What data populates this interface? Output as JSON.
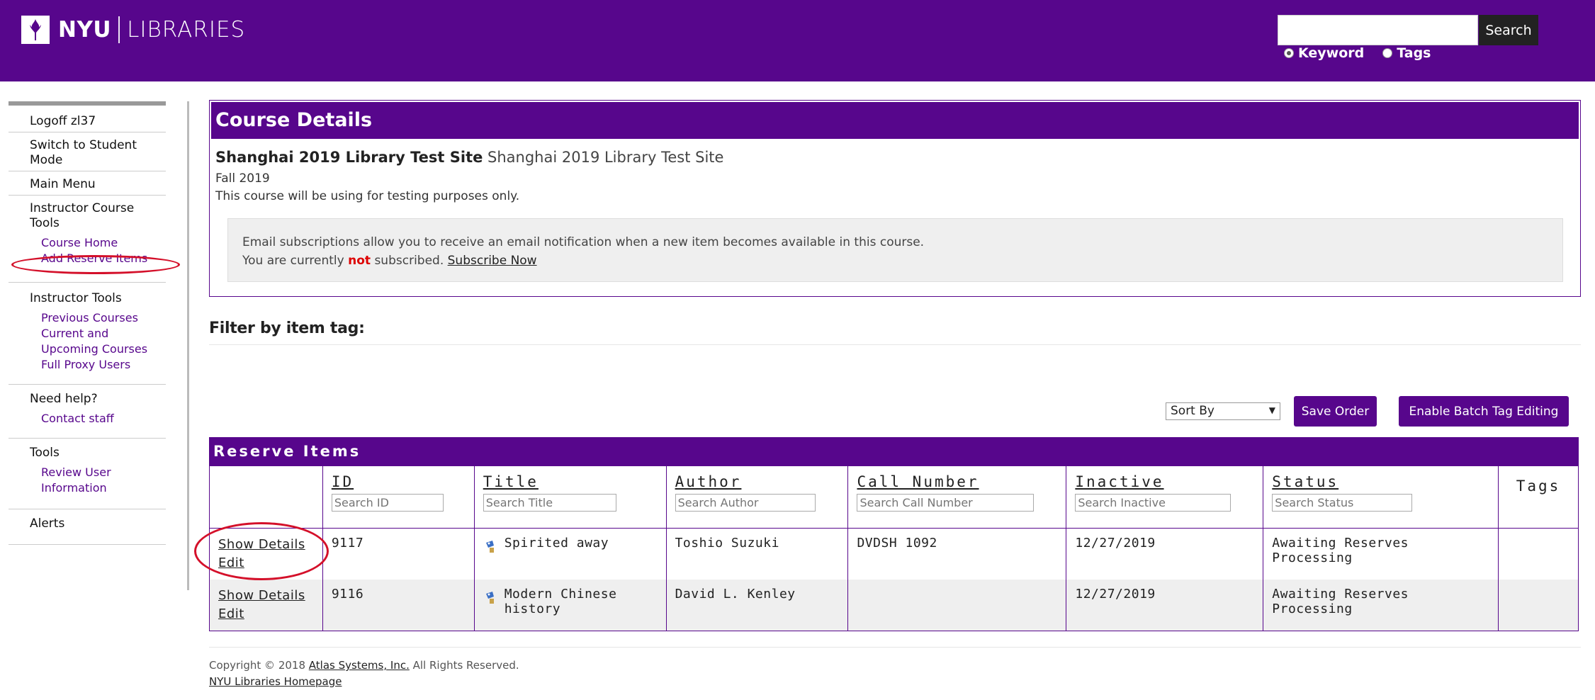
{
  "header": {
    "logo_nyu": "NYU",
    "logo_libraries": "LIBRARIES",
    "search": {
      "value": "",
      "placeholder": "",
      "button_label": "Search"
    },
    "search_type": [
      {
        "label": "Keyword",
        "selected": true
      },
      {
        "label": "Tags",
        "selected": false
      }
    ]
  },
  "sidebar": {
    "sections": [
      {
        "head": "Logoff zl37",
        "links": []
      },
      {
        "head": "Switch to Student Mode",
        "links": []
      },
      {
        "head": "Main Menu",
        "links": []
      },
      {
        "head": "Instructor Course Tools",
        "links": [
          "Course Home",
          "Add Reserve Items"
        ]
      },
      {
        "head": "Instructor Tools",
        "links": [
          "Previous Courses",
          "Current and Upcoming Courses",
          "Full Proxy Users"
        ]
      },
      {
        "head": "Need help?",
        "links": [
          "Contact staff"
        ]
      },
      {
        "head": "Tools",
        "links": [
          "Review User Information"
        ]
      },
      {
        "head": "Alerts",
        "links": []
      }
    ]
  },
  "course": {
    "heading": "Course Details",
    "name_bold": "Shanghai 2019 Library Test Site",
    "name_plain": "Shanghai 2019 Library Test Site",
    "term": "Fall 2019",
    "description": "This course will be using for testing purposes only.",
    "email_line1": "Email subscriptions allow you to receive an email notification when a new item becomes available in this course.",
    "email_line2_pre": "You are currently ",
    "email_line2_not": "not",
    "email_line2_post": " subscribed. ",
    "subscribe_label": "Subscribe Now"
  },
  "filter": {
    "title": "Filter by item tag:"
  },
  "controls": {
    "sort_label": "Sort By",
    "save_order": "Save Order",
    "batch_tag": "Enable Batch Tag Editing"
  },
  "reserve": {
    "heading": "Reserve Items",
    "columns": [
      {
        "label": "ID",
        "placeholder": "Search ID"
      },
      {
        "label": "Title",
        "placeholder": "Search Title"
      },
      {
        "label": "Author",
        "placeholder": "Search Author"
      },
      {
        "label": "Call Number",
        "placeholder": "Search Call Number"
      },
      {
        "label": "Inactive",
        "placeholder": "Search Inactive"
      },
      {
        "label": "Status",
        "placeholder": "Search Status"
      }
    ],
    "tags_label": "Tags",
    "action_show": "Show Details",
    "action_edit": "Edit",
    "rows": [
      {
        "id": "9117",
        "title": "Spirited away",
        "author": "Toshio Suzuki",
        "call_number": "DVDSH 1092",
        "inactive": "12/27/2019",
        "status": "Awaiting Reserves Processing",
        "tags": ""
      },
      {
        "id": "9116",
        "title": "Modern Chinese history",
        "author": "David L. Kenley",
        "call_number": "",
        "inactive": "12/27/2019",
        "status": "Awaiting Reserves Processing",
        "tags": ""
      }
    ]
  },
  "footer": {
    "copyright_pre": "Copyright © 2018 ",
    "atlas_link": "Atlas Systems, Inc.",
    "copyright_post": " All Rights Reserved.",
    "home_link": "NYU Libraries Homepage"
  },
  "colors": {
    "brand_purple": "#57068c",
    "annotation_red": "#d4102a",
    "not_red": "#dd0000"
  }
}
